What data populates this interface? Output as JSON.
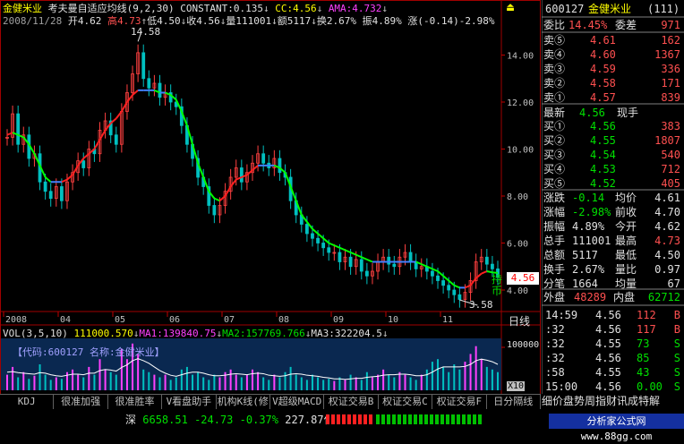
{
  "chart_title": {
    "stock_name": "金健米业",
    "indicator": "考夫曼自适应均线(9,2,30)",
    "constant": "CONSTANT:0.135",
    "cc": "CC:4.56",
    "ama": "AMA:4.732"
  },
  "info_line": {
    "date": "2008/11/28",
    "open": "开4.62",
    "high": "高4.73",
    "low": "低4.50",
    "close": "收4.56",
    "volume": "量111001",
    "amount": "额5117",
    "turnover": "换2.67%",
    "amplitude": "振4.89%",
    "change": "涨(-0.14)-2.98%"
  },
  "annotations": {
    "max_label": "14.58",
    "min_label": "3.58",
    "current_price": "4.56",
    "side_tag_1": "持",
    "side_tag_2": "币",
    "period": "日线"
  },
  "volume_header": {
    "vol": "VOL(3,5,10)",
    "vol_value": "111000.570",
    "ma1": "MA1:139840.75",
    "ma2": "MA2:157769.766",
    "ma3": "MA3:322204.5"
  },
  "volume_watermark": "【代码:600127 名称:金健米业】",
  "volume_axis": {
    "top": "100000",
    "unit": "X10"
  },
  "chart_data": {
    "type": "line",
    "x_ticks": [
      "2008",
      "04",
      "05",
      "06",
      "07",
      "08",
      "09",
      "10",
      "11"
    ],
    "y_ticks": [
      4.0,
      6.0,
      8.0,
      10.0,
      12.0,
      14.0
    ],
    "ylim": [
      3.2,
      15.2
    ],
    "price_close": [
      10.5,
      11.5,
      10.2,
      10.6,
      9.6,
      9.8,
      8.6,
      8.2,
      7.9,
      8.4,
      7.8,
      8.6,
      9.0,
      9.5,
      9.2,
      10.0,
      9.8,
      10.8,
      11.2,
      10.6,
      10.2,
      11.6,
      12.4,
      13.2,
      14.1,
      13.0,
      12.6,
      12.8,
      12.2,
      12.4,
      12.0,
      11.8,
      11.0,
      10.2,
      9.6,
      8.8,
      8.4,
      7.6,
      7.2,
      7.6,
      8.2,
      8.8,
      9.2,
      8.6,
      9.0,
      9.4,
      9.8,
      9.4,
      9.2,
      9.6,
      9.0,
      8.8,
      7.8,
      7.2,
      6.8,
      6.4,
      6.2,
      6.0,
      5.8,
      5.6,
      5.6,
      5.2,
      5.4,
      5.0,
      5.3,
      4.8,
      4.6,
      4.8,
      5.2,
      5.4,
      5.1,
      5.0,
      5.4,
      5.6,
      5.2,
      4.9,
      5.0,
      4.8,
      4.6,
      4.4,
      4.2,
      4.0,
      3.8,
      3.6,
      3.9,
      4.4,
      5.2,
      5.4,
      5.1,
      4.9,
      4.56
    ],
    "ama_line": [
      10.6,
      10.7,
      10.6,
      10.5,
      10.2,
      9.8,
      9.3,
      8.8,
      8.6,
      8.6,
      8.6,
      8.7,
      8.9,
      9.3,
      9.6,
      9.8,
      10.0,
      10.4,
      10.8,
      11.1,
      11.3,
      11.6,
      12.0,
      12.3,
      12.5,
      12.5,
      12.5,
      12.5,
      12.4,
      12.4,
      12.3,
      12.1,
      11.6,
      11.0,
      10.2,
      9.4,
      8.8,
      8.2,
      7.9,
      7.8,
      8.0,
      8.4,
      8.7,
      8.8,
      8.9,
      9.1,
      9.3,
      9.3,
      9.3,
      9.3,
      9.2,
      9.0,
      8.4,
      7.8,
      7.2,
      6.9,
      6.6,
      6.4,
      6.2,
      6.0,
      5.9,
      5.8,
      5.7,
      5.6,
      5.5,
      5.4,
      5.3,
      5.2,
      5.2,
      5.2,
      5.2,
      5.2,
      5.2,
      5.2,
      5.2,
      5.2,
      5.1,
      5.0,
      4.9,
      4.8,
      4.6,
      4.4,
      4.2,
      4.1,
      4.1,
      4.2,
      4.5,
      4.7,
      4.8,
      4.75,
      4.73
    ],
    "volume": [
      30,
      45,
      25,
      35,
      22,
      28,
      50,
      30,
      20,
      25,
      22,
      35,
      40,
      30,
      25,
      45,
      30,
      60,
      40,
      35,
      30,
      80,
      60,
      90,
      70,
      40,
      35,
      30,
      25,
      30,
      20,
      25,
      40,
      45,
      30,
      35,
      25,
      20,
      30,
      25,
      35,
      40,
      30,
      25,
      30,
      40,
      35,
      25,
      20,
      30,
      25,
      35,
      45,
      30,
      25,
      20,
      30,
      25,
      20,
      22,
      18,
      25,
      20,
      30,
      25,
      20,
      35,
      25,
      30,
      40,
      30,
      25,
      35,
      30,
      25,
      20,
      30,
      40,
      55,
      60,
      45,
      35,
      50,
      40,
      55,
      70,
      85,
      60,
      45,
      40,
      35
    ],
    "volume_ma": [
      35,
      36,
      34,
      33,
      32,
      31,
      34,
      33,
      30,
      28,
      27,
      29,
      31,
      31,
      30,
      33,
      33,
      38,
      40,
      39,
      37,
      44,
      49,
      57,
      61,
      57,
      52,
      45,
      38,
      33,
      29,
      27,
      30,
      33,
      35,
      35,
      33,
      30,
      28,
      28,
      29,
      31,
      32,
      31,
      30,
      32,
      33,
      32,
      29,
      28,
      27,
      28,
      31,
      32,
      31,
      29,
      28,
      27,
      25,
      24,
      22,
      22,
      21,
      22,
      23,
      23,
      25,
      26,
      27,
      29,
      30,
      30,
      31,
      31,
      30,
      28,
      28,
      30,
      35,
      41,
      45,
      45,
      45,
      45,
      46,
      50,
      57,
      60,
      58,
      55,
      50
    ]
  },
  "quote_panel": {
    "code": "600127",
    "name": "金健米业",
    "code_suffix": "(111)",
    "weibi_label": "委比",
    "weibi_value": "14.45%",
    "weicha_label": "委差",
    "weicha_value": "971",
    "sells": [
      {
        "label": "卖⑤",
        "price": "4.61",
        "vol": "162"
      },
      {
        "label": "卖④",
        "price": "4.60",
        "vol": "1367"
      },
      {
        "label": "卖③",
        "price": "4.59",
        "vol": "336"
      },
      {
        "label": "卖②",
        "price": "4.58",
        "vol": "171"
      },
      {
        "label": "卖①",
        "price": "4.57",
        "vol": "839"
      }
    ],
    "latest_label": "最新",
    "latest_value": "4.56",
    "current_hand_label": "现手",
    "buys": [
      {
        "label": "买①",
        "price": "4.56",
        "vol": "383"
      },
      {
        "label": "买②",
        "price": "4.55",
        "vol": "1807"
      },
      {
        "label": "买③",
        "price": "4.54",
        "vol": "540"
      },
      {
        "label": "买④",
        "price": "4.53",
        "vol": "712"
      },
      {
        "label": "买⑤",
        "price": "4.52",
        "vol": "405"
      }
    ],
    "stats": [
      {
        "l1": "涨跌",
        "v1": "-0.14",
        "l2": "均价",
        "v2": "4.61"
      },
      {
        "l1": "涨幅",
        "v1": "-2.98%",
        "l2": "前收",
        "v2": "4.70"
      },
      {
        "l1": "振幅",
        "v1": "4.89%",
        "l2": "今开",
        "v2": "4.62"
      },
      {
        "l1": "总手",
        "v1": "111001",
        "l2": "最高",
        "v2": "4.73"
      },
      {
        "l1": "总额",
        "v1": "5117",
        "l2": "最低",
        "v2": "4.50"
      },
      {
        "l1": "换手",
        "v1": "2.67%",
        "l2": "量比",
        "v2": "0.97"
      },
      {
        "l1": "分笔",
        "v1": "1664",
        "l2": "均量",
        "v2": "67"
      }
    ],
    "waipan_label": "外盘",
    "waipan_value": "48289",
    "neipan_label": "内盘",
    "neipan_value": "62712",
    "ticks": [
      {
        "time": "14:59",
        "price": "4.56",
        "vol": "112",
        "bs": "B"
      },
      {
        "time": ":32",
        "price": "4.56",
        "vol": "117",
        "bs": "B"
      },
      {
        "time": ":32",
        "price": "4.55",
        "vol": "73",
        "bs": "S"
      },
      {
        "time": ":32",
        "price": "4.56",
        "vol": "85",
        "bs": "S"
      },
      {
        "time": ":58",
        "price": "4.55",
        "vol": "43",
        "bs": "S"
      },
      {
        "time": "15:00",
        "price": "4.56",
        "vol": "0.00",
        "bs": "S"
      }
    ]
  },
  "tabs": [
    "KDJ",
    "很准加强",
    "很准胜率",
    "V看盘助手",
    "机构K线(修",
    "V超级MACD",
    "权证交易B",
    "权证交易C",
    "权证交易F",
    "日分隔线"
  ],
  "right_tabs": "细价盘势周指财讯成特解",
  "status": {
    "index_name": "深",
    "index_value": "6658.51",
    "index_change": "-24.73",
    "index_pct": "-0.37%",
    "index_amount": "227.87亿",
    "logo_text": "分析家公式网 www.88gg.com"
  }
}
